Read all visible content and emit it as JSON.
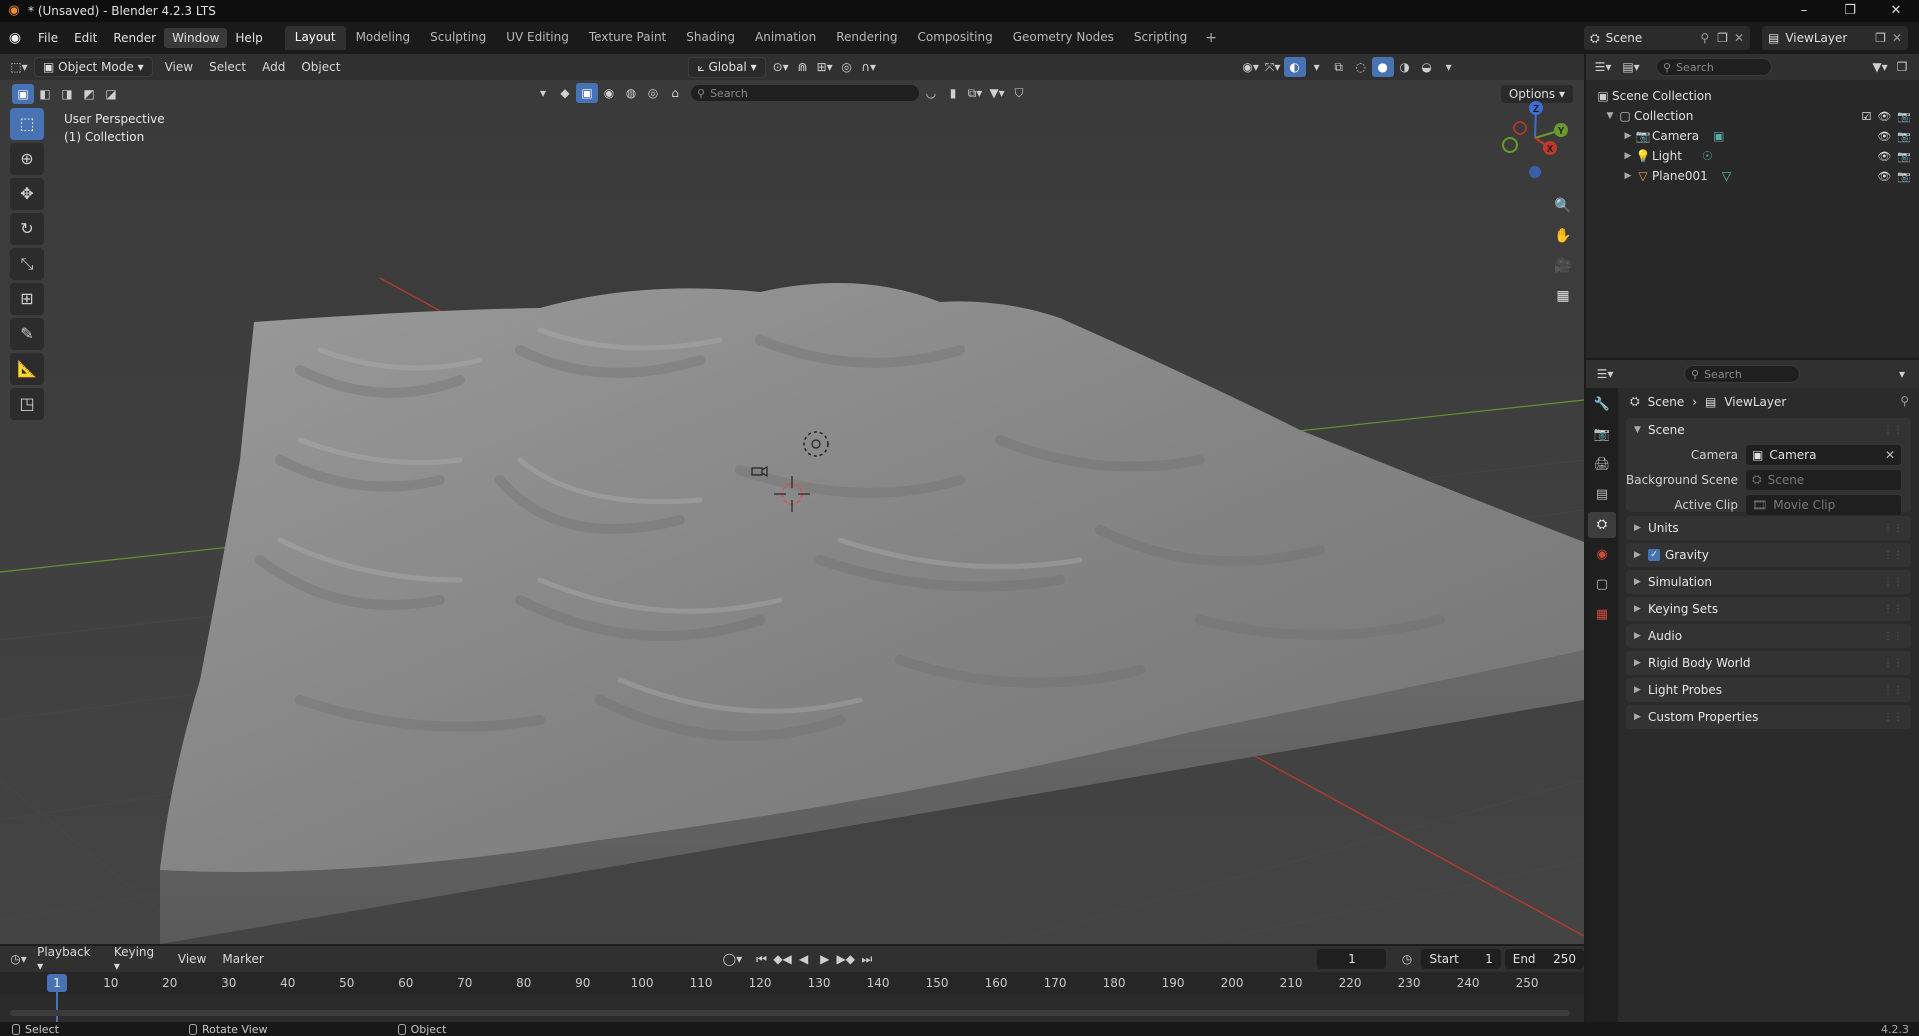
{
  "window": {
    "title": "* (Unsaved) - Blender 4.2.3 LTS",
    "minimize": "–",
    "maximize": "❐",
    "close": "✕"
  },
  "menu": [
    "File",
    "Edit",
    "Render",
    "Window",
    "Help"
  ],
  "workspaces": [
    "Layout",
    "Modeling",
    "Sculpting",
    "UV Editing",
    "Texture Paint",
    "Shading",
    "Animation",
    "Rendering",
    "Compositing",
    "Geometry Nodes",
    "Scripting"
  ],
  "workspace_add": "+",
  "scene_selector": {
    "scene": "Scene",
    "view_layer": "ViewLayer"
  },
  "viewport": {
    "mode": "Object Mode",
    "menus": [
      "View",
      "Select",
      "Add",
      "Object"
    ],
    "transform_orientation": "Global",
    "search_placeholder": "Search",
    "options": "Options",
    "info_line1": "User Perspective",
    "info_line2": "(1) Collection",
    "gizmo_axes": {
      "z": "Z",
      "y": "Y",
      "x": "X"
    },
    "colors": {
      "background": "#3d3d3d",
      "terrain": "#8a8a8a",
      "x_axis": "#c0392b",
      "y_axis": "#6a9a2a",
      "accent": "#4772b3"
    }
  },
  "outliner": {
    "search_placeholder": "Search",
    "root": "Scene Collection",
    "collection": "Collection",
    "items": [
      {
        "name": "Camera",
        "icon": "camera-icon"
      },
      {
        "name": "Light",
        "icon": "light-icon"
      },
      {
        "name": "Plane001",
        "icon": "mesh-icon"
      }
    ]
  },
  "properties": {
    "search_placeholder": "Search",
    "breadcrumb": [
      "Scene",
      "ViewLayer"
    ],
    "scene_panel": {
      "title": "Scene",
      "camera_label": "Camera",
      "camera_value": "Camera",
      "background_scene_label": "Background Scene",
      "background_scene_placeholder": "Scene",
      "active_clip_label": "Active Clip",
      "active_clip_placeholder": "Movie Clip"
    },
    "collapsed_panels": [
      "Units",
      "Gravity",
      "Simulation",
      "Keying Sets",
      "Audio",
      "Rigid Body World",
      "Light Probes",
      "Custom Properties"
    ],
    "gravity_checked": true
  },
  "timeline": {
    "menus": [
      "Playback",
      "Keying",
      "View",
      "Marker"
    ],
    "current_frame": "1",
    "start_label": "Start",
    "start_value": "1",
    "end_label": "End",
    "end_value": "250",
    "ruler": [
      "10",
      "20",
      "30",
      "40",
      "50",
      "60",
      "70",
      "80",
      "90",
      "100",
      "110",
      "120",
      "130",
      "140",
      "150",
      "160",
      "170",
      "180",
      "190",
      "200",
      "210",
      "220",
      "230",
      "240",
      "250"
    ],
    "playhead_label": "1"
  },
  "statusbar": {
    "select": "Select",
    "rotate_view": "Rotate View",
    "object": "Object",
    "version": "4.2.3"
  }
}
